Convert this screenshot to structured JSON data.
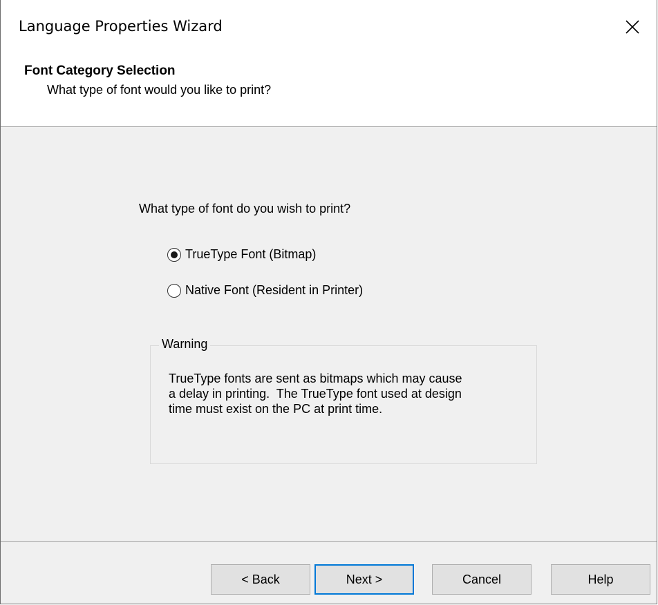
{
  "window": {
    "title": "Language Properties Wizard",
    "close_icon": "close-icon"
  },
  "header": {
    "title": "Font Category Selection",
    "subtitle": "What type of font would you like to print?"
  },
  "content": {
    "question": "What type of font do you wish to print?",
    "options": [
      {
        "label": "TrueType Font (Bitmap)",
        "selected": true
      },
      {
        "label": "Native Font (Resident in Printer)",
        "selected": false
      }
    ],
    "warning": {
      "legend": "Warning",
      "lines": [
        "TrueType fonts are sent as bitmaps which may cause",
        "a delay in printing.  The TrueType font used at design",
        "time must exist on the PC at print time."
      ]
    }
  },
  "footer": {
    "back_label": "< Back",
    "next_label": "Next >",
    "cancel_label": "Cancel",
    "help_label": "Help"
  },
  "colors": {
    "default_button_border": "#0078d7",
    "dialog_background": "#f0f0f0"
  }
}
